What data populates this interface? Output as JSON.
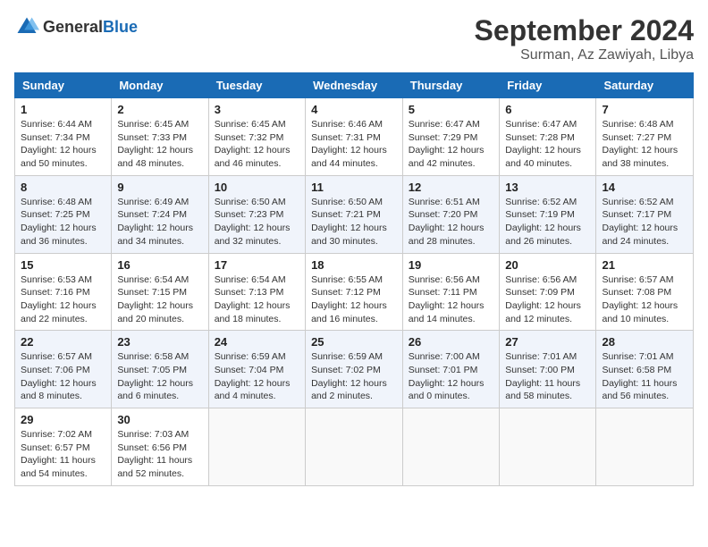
{
  "logo": {
    "general": "General",
    "blue": "Blue"
  },
  "header": {
    "month": "September 2024",
    "location": "Surman, Az Zawiyah, Libya"
  },
  "weekdays": [
    "Sunday",
    "Monday",
    "Tuesday",
    "Wednesday",
    "Thursday",
    "Friday",
    "Saturday"
  ],
  "weeks": [
    [
      {
        "day": 1,
        "sunrise": "6:44 AM",
        "sunset": "7:34 PM",
        "daylight": "12 hours and 50 minutes."
      },
      {
        "day": 2,
        "sunrise": "6:45 AM",
        "sunset": "7:33 PM",
        "daylight": "12 hours and 48 minutes."
      },
      {
        "day": 3,
        "sunrise": "6:45 AM",
        "sunset": "7:32 PM",
        "daylight": "12 hours and 46 minutes."
      },
      {
        "day": 4,
        "sunrise": "6:46 AM",
        "sunset": "7:31 PM",
        "daylight": "12 hours and 44 minutes."
      },
      {
        "day": 5,
        "sunrise": "6:47 AM",
        "sunset": "7:29 PM",
        "daylight": "12 hours and 42 minutes."
      },
      {
        "day": 6,
        "sunrise": "6:47 AM",
        "sunset": "7:28 PM",
        "daylight": "12 hours and 40 minutes."
      },
      {
        "day": 7,
        "sunrise": "6:48 AM",
        "sunset": "7:27 PM",
        "daylight": "12 hours and 38 minutes."
      }
    ],
    [
      {
        "day": 8,
        "sunrise": "6:48 AM",
        "sunset": "7:25 PM",
        "daylight": "12 hours and 36 minutes."
      },
      {
        "day": 9,
        "sunrise": "6:49 AM",
        "sunset": "7:24 PM",
        "daylight": "12 hours and 34 minutes."
      },
      {
        "day": 10,
        "sunrise": "6:50 AM",
        "sunset": "7:23 PM",
        "daylight": "12 hours and 32 minutes."
      },
      {
        "day": 11,
        "sunrise": "6:50 AM",
        "sunset": "7:21 PM",
        "daylight": "12 hours and 30 minutes."
      },
      {
        "day": 12,
        "sunrise": "6:51 AM",
        "sunset": "7:20 PM",
        "daylight": "12 hours and 28 minutes."
      },
      {
        "day": 13,
        "sunrise": "6:52 AM",
        "sunset": "7:19 PM",
        "daylight": "12 hours and 26 minutes."
      },
      {
        "day": 14,
        "sunrise": "6:52 AM",
        "sunset": "7:17 PM",
        "daylight": "12 hours and 24 minutes."
      }
    ],
    [
      {
        "day": 15,
        "sunrise": "6:53 AM",
        "sunset": "7:16 PM",
        "daylight": "12 hours and 22 minutes."
      },
      {
        "day": 16,
        "sunrise": "6:54 AM",
        "sunset": "7:15 PM",
        "daylight": "12 hours and 20 minutes."
      },
      {
        "day": 17,
        "sunrise": "6:54 AM",
        "sunset": "7:13 PM",
        "daylight": "12 hours and 18 minutes."
      },
      {
        "day": 18,
        "sunrise": "6:55 AM",
        "sunset": "7:12 PM",
        "daylight": "12 hours and 16 minutes."
      },
      {
        "day": 19,
        "sunrise": "6:56 AM",
        "sunset": "7:11 PM",
        "daylight": "12 hours and 14 minutes."
      },
      {
        "day": 20,
        "sunrise": "6:56 AM",
        "sunset": "7:09 PM",
        "daylight": "12 hours and 12 minutes."
      },
      {
        "day": 21,
        "sunrise": "6:57 AM",
        "sunset": "7:08 PM",
        "daylight": "12 hours and 10 minutes."
      }
    ],
    [
      {
        "day": 22,
        "sunrise": "6:57 AM",
        "sunset": "7:06 PM",
        "daylight": "12 hours and 8 minutes."
      },
      {
        "day": 23,
        "sunrise": "6:58 AM",
        "sunset": "7:05 PM",
        "daylight": "12 hours and 6 minutes."
      },
      {
        "day": 24,
        "sunrise": "6:59 AM",
        "sunset": "7:04 PM",
        "daylight": "12 hours and 4 minutes."
      },
      {
        "day": 25,
        "sunrise": "6:59 AM",
        "sunset": "7:02 PM",
        "daylight": "12 hours and 2 minutes."
      },
      {
        "day": 26,
        "sunrise": "7:00 AM",
        "sunset": "7:01 PM",
        "daylight": "12 hours and 0 minutes."
      },
      {
        "day": 27,
        "sunrise": "7:01 AM",
        "sunset": "7:00 PM",
        "daylight": "11 hours and 58 minutes."
      },
      {
        "day": 28,
        "sunrise": "7:01 AM",
        "sunset": "6:58 PM",
        "daylight": "11 hours and 56 minutes."
      }
    ],
    [
      {
        "day": 29,
        "sunrise": "7:02 AM",
        "sunset": "6:57 PM",
        "daylight": "11 hours and 54 minutes."
      },
      {
        "day": 30,
        "sunrise": "7:03 AM",
        "sunset": "6:56 PM",
        "daylight": "11 hours and 52 minutes."
      },
      null,
      null,
      null,
      null,
      null
    ]
  ]
}
